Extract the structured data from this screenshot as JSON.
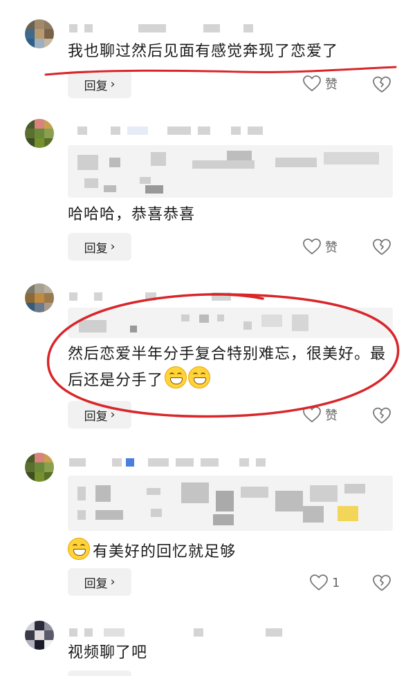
{
  "comments": [
    {
      "text": "我也聊过然后见面有感觉奔现了恋爱了",
      "reply_label": "回复",
      "like_label": "赞"
    },
    {
      "text": "哈哈哈，恭喜恭喜",
      "reply_label": "回复",
      "like_label": "赞"
    },
    {
      "text": "然后恋爱半年分手复合特别难忘，很美好。最后还是分手了",
      "reply_label": "回复",
      "like_label": "赞"
    },
    {
      "text": "有美好的回忆就足够",
      "reply_label": "回复",
      "like_label": "1"
    },
    {
      "text": "视频聊了吧"
    }
  ],
  "colors": {
    "annotation_red": "#d8262a",
    "reply_bg": "#f1f1f1",
    "quote_bg": "#f3f3f3",
    "icon_gray": "#777777",
    "emoji_yellow": "#ffd43b"
  },
  "icons": {
    "like": "heart-outline-icon",
    "dislike": "broken-heart-icon",
    "chevron": "chevron-right-icon",
    "emoji": "grinning-face-emoji"
  }
}
